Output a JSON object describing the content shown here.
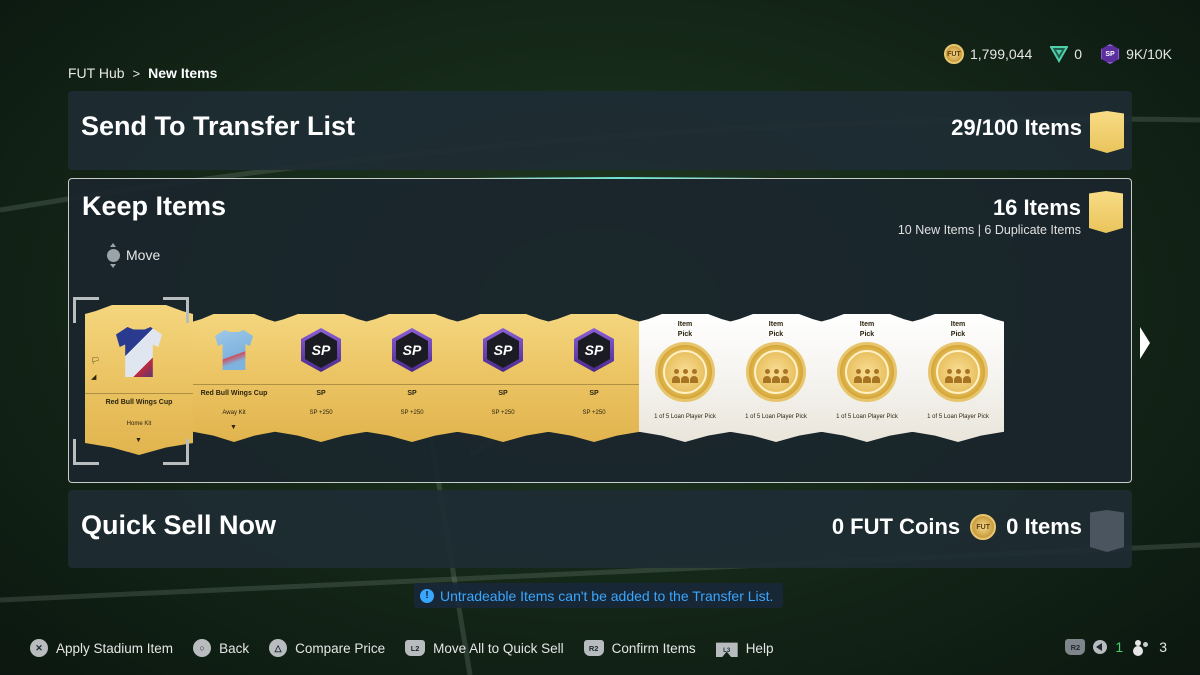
{
  "breadcrumb": {
    "root": "FUT Hub",
    "separator": ">",
    "current": "New Items"
  },
  "currencies": {
    "coins": "1,799,044",
    "points": "0",
    "sp": "9K/10K",
    "coin_icon": "fut-coin-icon",
    "points_icon": "fc-points-icon",
    "sp_icon": "sp-icon"
  },
  "sections": {
    "transfer": {
      "title": "Send To Transfer List",
      "count": "29/100 Items"
    },
    "keep": {
      "title": "Keep Items",
      "count": "16 Items",
      "breakdown": "10 New Items | 6 Duplicate Items",
      "move_hint": "Move"
    },
    "quick_sell": {
      "title": "Quick Sell Now",
      "coins": "0 FUT Coins",
      "items": "0 Items"
    }
  },
  "cards": [
    {
      "type": "kit",
      "title": "Red Bull Wings Cup",
      "subtitle": "Home Kit",
      "style": "gold"
    },
    {
      "type": "kit",
      "title": "Red Bull Wings Cup",
      "subtitle": "Away Kit",
      "style": "gold"
    },
    {
      "type": "sp",
      "badge": "SP",
      "title": "SP",
      "subtitle": "SP +250",
      "style": "gold"
    },
    {
      "type": "sp",
      "badge": "SP",
      "title": "SP",
      "subtitle": "SP +250",
      "style": "gold"
    },
    {
      "type": "sp",
      "badge": "SP",
      "title": "SP",
      "subtitle": "SP +250",
      "style": "gold"
    },
    {
      "type": "sp",
      "badge": "SP",
      "title": "SP",
      "subtitle": "SP +250",
      "style": "gold"
    },
    {
      "type": "pick",
      "header1": "Item",
      "header2": "Pick",
      "subtitle": "1 of 5 Loan Player Pick",
      "style": "white"
    },
    {
      "type": "pick",
      "header1": "Item",
      "header2": "Pick",
      "subtitle": "1 of 5 Loan Player Pick",
      "style": "white"
    },
    {
      "type": "pick",
      "header1": "Item",
      "header2": "Pick",
      "subtitle": "1 of 5 Loan Player Pick",
      "style": "white"
    },
    {
      "type": "pick",
      "header1": "Item",
      "header2": "Pick",
      "subtitle": "1 of 5 Loan Player Pick",
      "style": "white"
    }
  ],
  "notice": {
    "text": "Untradeable Items can't be added to the Transfer List.",
    "icon": "info-icon",
    "color": "#39a6ff"
  },
  "footer": {
    "buttons": [
      {
        "icon": "cross-button-icon",
        "glyph": "✕",
        "label": "Apply Stadium Item"
      },
      {
        "icon": "circle-button-icon",
        "glyph": "○",
        "label": "Back"
      },
      {
        "icon": "triangle-button-icon",
        "glyph": "△",
        "label": "Compare Price"
      },
      {
        "icon": "l2-button-icon",
        "glyph": "L2",
        "label": "Move All to Quick Sell"
      },
      {
        "icon": "r2-button-icon",
        "glyph": "R2",
        "label": "Confirm Items"
      },
      {
        "icon": "touchpad-button-icon",
        "glyph": "L3",
        "label": "Help"
      }
    ],
    "right": {
      "r2": "R2",
      "voice_count": "1",
      "players_count": "3"
    }
  },
  "colors": {
    "gold_card": "#ecc565",
    "panel_bg": "#1e2c34",
    "accent_blue": "#39a6ff",
    "green": "#44d36a"
  }
}
